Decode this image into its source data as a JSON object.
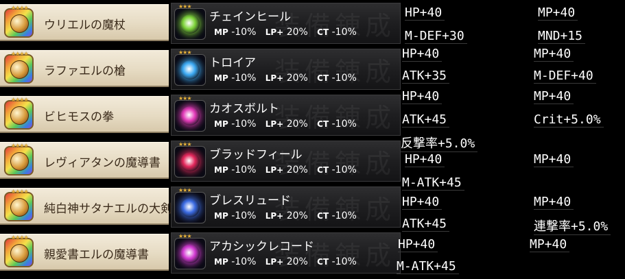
{
  "weapons": [
    {
      "name": "ウリエルの魔杖",
      "stars": "★★★★"
    },
    {
      "name": "ラファエルの槍",
      "stars": "★★★★"
    },
    {
      "name": "ビヒモスの拳",
      "stars": "★★★★"
    },
    {
      "name": "レヴィアタンの魔導書",
      "stars": "★★★★"
    },
    {
      "name": "純白神サタナエルの大剣",
      "stars": "★★★★"
    },
    {
      "name": "親愛書エルの魔導書",
      "stars": "★★★★"
    }
  ],
  "skills": [
    {
      "name": "チェインヒール",
      "stars": "★★★",
      "mp_label": "MP",
      "mp": "-10%",
      "lp_label": "LP+",
      "lp": "20%",
      "ct_label": "CT",
      "ct": "-10%",
      "color": "#7ed43a"
    },
    {
      "name": "トロイア",
      "stars": "★★★",
      "mp_label": "MP",
      "mp": "-10%",
      "lp_label": "LP+",
      "lp": "20%",
      "ct_label": "CT",
      "ct": "-10%",
      "color": "#3aa8f2"
    },
    {
      "name": "カオスボルト",
      "stars": "★★★",
      "mp_label": "MP",
      "mp": "-10%",
      "lp_label": "LP+",
      "lp": "20%",
      "ct_label": "CT",
      "ct": "-10%",
      "color": "#e23ab8"
    },
    {
      "name": "ブラッドフィール",
      "stars": "★★★",
      "mp_label": "MP",
      "mp": "-10%",
      "lp_label": "LP+",
      "lp": "20%",
      "ct_label": "CT",
      "ct": "-10%",
      "color": "#e2265a"
    },
    {
      "name": "ブレスリュード",
      "stars": "★★★",
      "mp_label": "MP",
      "mp": "-10%",
      "lp_label": "LP+",
      "lp": "20%",
      "ct_label": "CT",
      "ct": "-10%",
      "color": "#3a6ae2"
    },
    {
      "name": "アカシックレコード",
      "stars": "★★★",
      "mp_label": "MP",
      "mp": "-10%",
      "lp_label": "LP+",
      "lp": "20%",
      "ct_label": "CT",
      "ct": "-10%",
      "color": "#d23ad2"
    }
  ],
  "skill_watermark": "装備錬成",
  "stats": [
    {
      "left": "HP+40",
      "right": "MP+40",
      "left2": "M-DEF+30",
      "right2": "MND+15"
    },
    {
      "left": "HP+40",
      "right": "MP+40",
      "left2": "ATK+35",
      "right2": "M-DEF+40"
    },
    {
      "left": "HP+40",
      "right": "MP+40",
      "left2": "ATK+45",
      "right2": "Crit+5.0%",
      "extra": "反撃率+5.0%"
    },
    {
      "left": "HP+40",
      "right": "MP+40",
      "left2": "M-ATK+45"
    },
    {
      "left": "HP+40",
      "right": "MP+40",
      "left2": "ATK+45",
      "right2": "連撃率+5.0%"
    },
    {
      "left": "HP+40",
      "right": "MP+40",
      "left2": "M-ATK+45"
    }
  ]
}
